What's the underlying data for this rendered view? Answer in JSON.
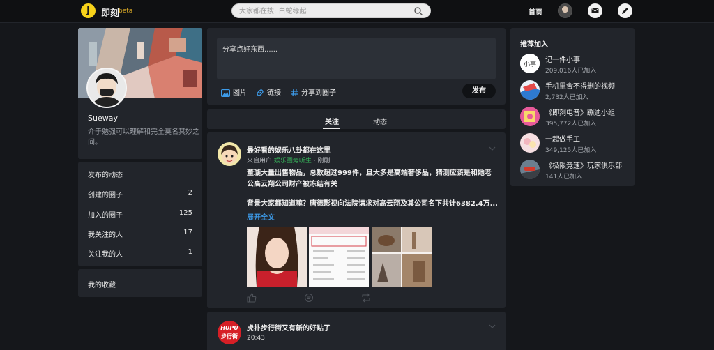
{
  "header": {
    "logo_letter": "J",
    "app_name": "即刻",
    "beta_label": "beta",
    "search_placeholder": "大家都在搜: 白蛇缘起",
    "home_label": "首页"
  },
  "profile": {
    "name": "Sueway",
    "bio": "介于勉强可以理解和完全莫名其妙之间。",
    "activity_title": "发布的动态",
    "stats": [
      {
        "label": "创建的圈子",
        "value": "2"
      },
      {
        "label": "加入的圈子",
        "value": "125"
      },
      {
        "label": "我关注的人",
        "value": "17"
      },
      {
        "label": "关注我的人",
        "value": "1"
      }
    ],
    "favorites_label": "我的收藏"
  },
  "composer": {
    "placeholder": "分享点好东西......",
    "tools": {
      "image": "图片",
      "link": "链接",
      "share_circle": "分享到圈子"
    },
    "publish_label": "发布"
  },
  "tabs": {
    "following": "关注",
    "moments": "动态"
  },
  "posts": [
    {
      "title": "最好看的娱乐八卦都在这里",
      "author": "来自用户",
      "topic": "娱乐圈旁听生",
      "time": "· 刚刚",
      "body_1": "董璇大量出售物品，总数超过999件，且大多是高端奢侈品，猜测应该是和她老公高云翔公司财产被冻结有关",
      "body_2": "背景大家都知道嘛？唐德影视向法院请求对高云翔及其公司名下共计6382.4万...",
      "expand_label": "展开全文"
    },
    {
      "title": "虎扑步行街又有新的好贴了",
      "time": "20:43",
      "avatar_text_1": "HUPU",
      "avatar_text_2": "步行街"
    }
  ],
  "recommend": {
    "title": "推荐加入",
    "items": [
      {
        "name": "记一件小事",
        "count": "209,016人已加入"
      },
      {
        "name": "手机里舍不得删的视频",
        "count": "2,732人已加入"
      },
      {
        "name": "《即刻电音》蹦迪小组",
        "count": "395,772人已加入"
      },
      {
        "name": "一起做手工",
        "count": "349,125人已加入"
      },
      {
        "name": "《极限竞速》玩家俱乐部",
        "count": "141人已加入"
      }
    ]
  },
  "colors": {
    "accent_yellow": "#f7d21a",
    "link_blue": "#3d9be9",
    "topic_green": "#36b35a",
    "panel": "#22252b"
  }
}
